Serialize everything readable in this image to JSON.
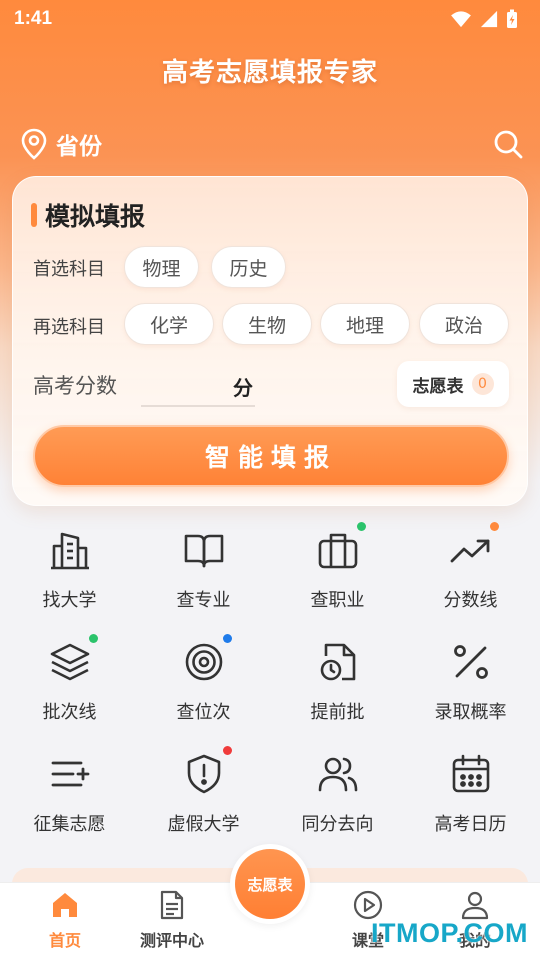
{
  "status": {
    "time": "1:41"
  },
  "header": {
    "title": "高考志愿填报专家",
    "province_label": "省份"
  },
  "card": {
    "title": "模拟填报",
    "first_subject_label": "首选科目",
    "first_subjects": [
      "物理",
      "历史"
    ],
    "second_subject_label": "再选科目",
    "second_subjects": [
      "化学",
      "生物",
      "地理",
      "政治"
    ],
    "score_label": "高考分数",
    "score_value": "",
    "score_unit": "分",
    "wish_label": "志愿表",
    "wish_count": "0",
    "smart_button": "智能填报"
  },
  "grid": [
    {
      "label": "找大学",
      "icon": "university-building-icon"
    },
    {
      "label": "查专业",
      "icon": "open-book-icon"
    },
    {
      "label": "查职业",
      "icon": "briefcase-icon",
      "dot": "#2bc36b"
    },
    {
      "label": "分数线",
      "icon": "trending-up-icon",
      "dot": "#ff8a3d"
    },
    {
      "label": "批次线",
      "icon": "layers-icon",
      "dot": "#2bc36b"
    },
    {
      "label": "查位次",
      "icon": "target-icon",
      "dot": "#1f7bea"
    },
    {
      "label": "提前批",
      "icon": "file-clock-icon"
    },
    {
      "label": "录取概率",
      "icon": "percent-icon"
    },
    {
      "label": "征集志愿",
      "icon": "list-add-icon"
    },
    {
      "label": "虚假大学",
      "icon": "shield-alert-icon",
      "dot": "#f03b3b"
    },
    {
      "label": "同分去向",
      "icon": "users-icon"
    },
    {
      "label": "高考日历",
      "icon": "calendar-icon"
    }
  ],
  "tabs": [
    {
      "label": "首页",
      "icon": "home-icon",
      "active": true
    },
    {
      "label": "测评中心",
      "icon": "document-icon"
    },
    {
      "label": "课堂",
      "icon": "play-circle-icon"
    },
    {
      "label": "我的",
      "icon": "user-icon"
    }
  ],
  "fab": {
    "label": "志愿表"
  },
  "watermark": "ITMOP.COM",
  "colors": {
    "accent": "#ff8a3d",
    "text": "#333333"
  }
}
